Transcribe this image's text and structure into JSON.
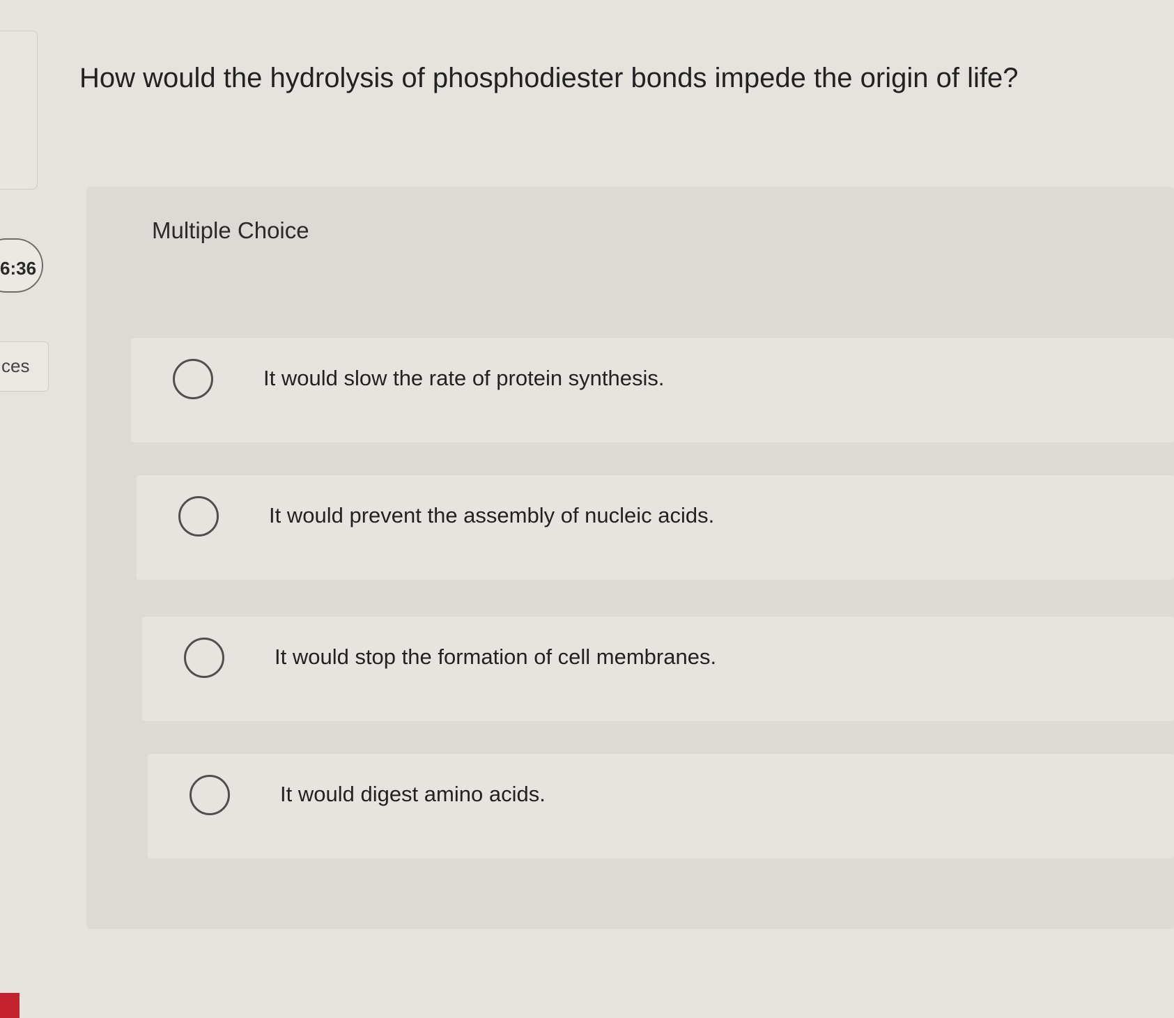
{
  "timer": {
    "text": "6:36"
  },
  "sidebar": {
    "resources_label": "ces"
  },
  "question": {
    "text": "How would the hydrolysis of phosphodiester bonds impede the origin of life?"
  },
  "multiple_choice": {
    "label": "Multiple Choice",
    "options": [
      {
        "text": "It would slow the rate of protein synthesis.",
        "selected": false
      },
      {
        "text": "It would prevent the assembly of nucleic acids.",
        "selected": false
      },
      {
        "text": "It would stop the formation of cell membranes.",
        "selected": false
      },
      {
        "text": "It would digest amino acids.",
        "selected": false
      }
    ]
  },
  "colors": {
    "background": "#e6e3de",
    "card": "#dddad5",
    "accent_red": "#c4232e"
  }
}
